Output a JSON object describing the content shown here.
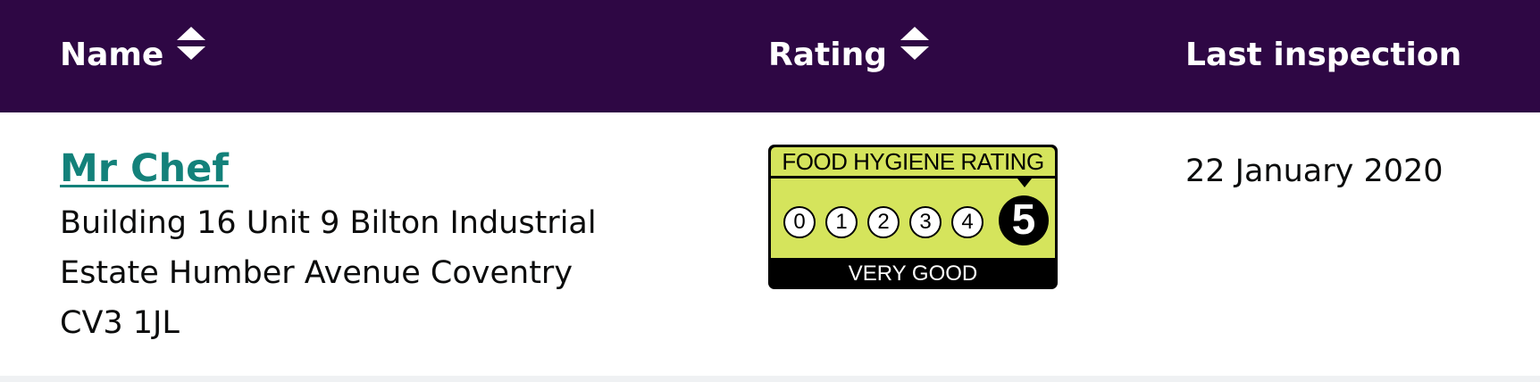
{
  "columns": {
    "name": "Name",
    "rating": "Rating",
    "last_inspection": "Last inspection"
  },
  "colors": {
    "header_bg": "#2e0744",
    "link": "#13817a",
    "badge_bg": "#d5e45c"
  },
  "icons": {
    "sort": "sort-up-down-icon"
  },
  "establishment": {
    "name": "Mr Chef",
    "address_lines": [
      "Building 16 Unit 9 Bilton Industrial",
      "Estate Humber Avenue Coventry",
      "CV3 1JL"
    ],
    "rating": {
      "title": "FOOD HYGIENE RATING",
      "scale": [
        "0",
        "1",
        "2",
        "3",
        "4",
        "5"
      ],
      "value": "5",
      "label": "VERY GOOD"
    },
    "last_inspection": "22 January 2020"
  }
}
